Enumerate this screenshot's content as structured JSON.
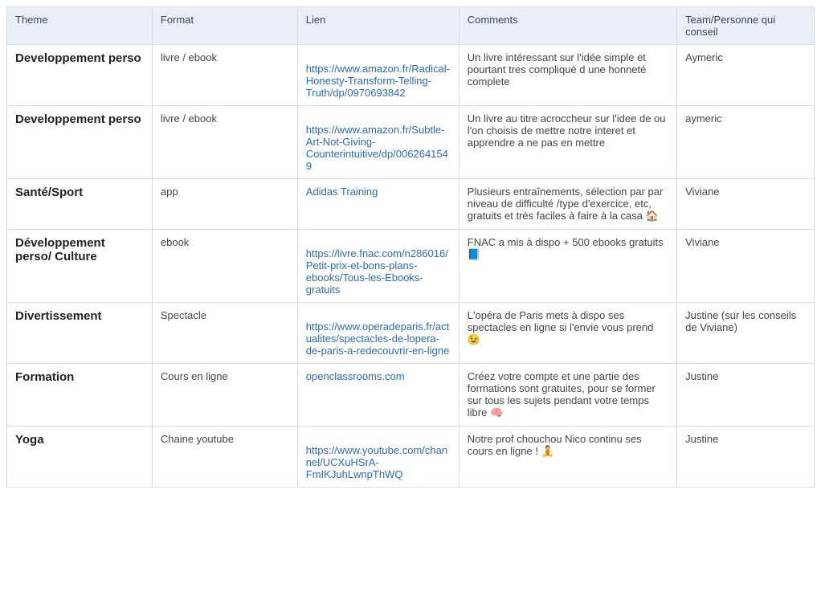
{
  "headers": {
    "theme": "Theme",
    "format": "Format",
    "lien": "Lien",
    "comments": "Comments",
    "team": "Team/Personne qui conseil"
  },
  "rows": [
    {
      "theme": "Developpement perso",
      "format": "livre / ebook",
      "lien": "https://www.amazon.fr/Radical-Honesty-Transform-Telling-Truth/dp/0970693842",
      "comments": "Un livre intéressant sur l'idée simple et pourtant tres compliqué d une honneté complete",
      "team": "Aymeric"
    },
    {
      "theme": "Developpement perso",
      "format": "livre / ebook",
      "lien": "https://www.amazon.fr/Subtle-Art-Not-Giving-Counterintuitive/dp/0062641549",
      "comments": "Un livre au titre acroccheur sur l'idee de ou l'on choisis de mettre notre interet et apprendre a ne pas en mettre",
      "team": "aymeric"
    },
    {
      "theme": "Santé/Sport",
      "format": "app",
      "lien": "Adidas Training",
      "comments": "Plusieurs entraînements, sélection par par niveau de difficulté /type d'exercice, etc, gratuits et très faciles à faire à la casa 🏠",
      "team": "Viviane"
    },
    {
      "theme": "Développement perso/ Culture",
      "format": "ebook",
      "lien": "https://livre.fnac.com/n286016/Petit-prix-et-bons-plans-ebooks/Tous-les-Ebooks-gratuits",
      "comments": "FNAC a mis à dispo + 500 ebooks gratuits 📘",
      "team": "Viviane"
    },
    {
      "theme": "Divertissement",
      "format": "Spectacle",
      "lien": "https://www.operadeparis.fr/actualites/spectacles-de-lopera-de-paris-a-redecouvrir-en-ligne",
      "comments": "L'opéra de Paris mets à dispo ses spectacles en ligne si l'envie vous prend 😉",
      "team": "Justine (sur les conseils de Viviane)"
    },
    {
      "theme": "Formation",
      "format": "Cours en ligne",
      "lien": "openclassrooms.com",
      "comments": "Créez votre compte et une partie des formations sont gratuites, pour se former sur tous les sujets pendant votre temps libre 🧠",
      "team": "Justine"
    },
    {
      "theme": "Yoga",
      "format": "Chaine youtube",
      "lien": "https://www.youtube.com/channel/UCXuHSrA-FmIKJuhLwnpThWQ",
      "comments": "Notre prof chouchou Nico continu ses cours en ligne ! 🧘",
      "team": "Justine"
    }
  ]
}
